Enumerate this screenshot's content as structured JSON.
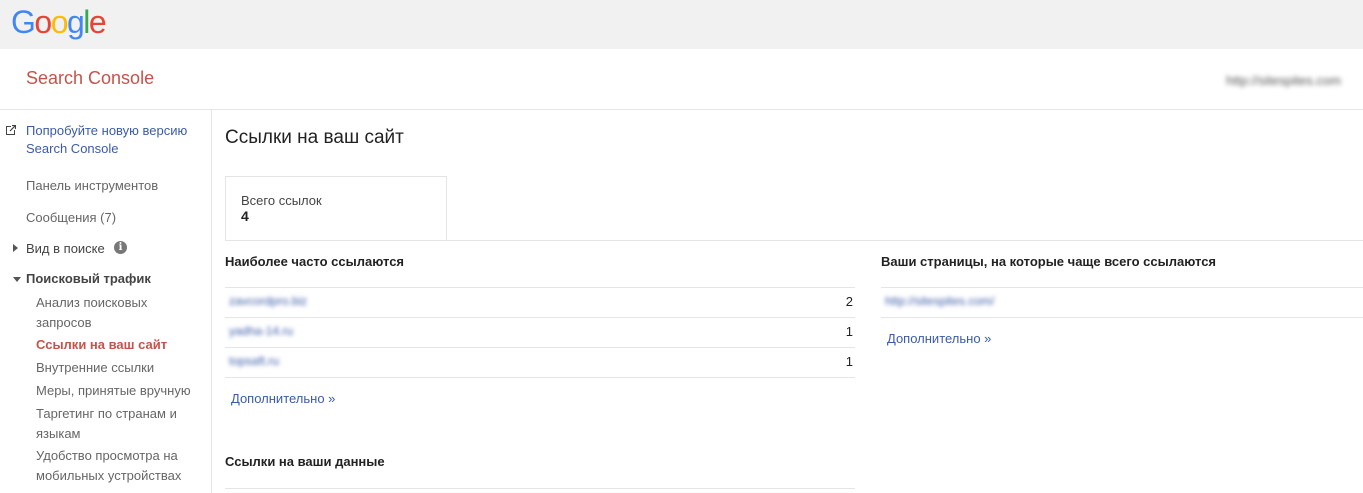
{
  "header": {
    "logo": [
      "G",
      "o",
      "o",
      "g",
      "l",
      "e"
    ],
    "logo_colors": [
      "#4285F4",
      "#EA4335",
      "#FBBC05",
      "#4285F4",
      "#34A853",
      "#EA4335"
    ],
    "app_title": "Search Console",
    "site_url": "http://sitespites.com"
  },
  "sidebar": {
    "try_new": "Попробуйте новую версию Search Console",
    "dashboard": "Панель инструментов",
    "messages": "Сообщения (7)",
    "search_appearance": "Вид в поиске",
    "search_traffic": "Поисковый трафик",
    "sub_items": [
      "Анализ поисковых запросов",
      "Ссылки на ваш сайт",
      "Внутренние ссылки",
      "Меры, принятые вручную",
      "Таргетинг по странам и языкам",
      "Удобство просмотра на мобильных устройствах"
    ]
  },
  "main": {
    "page_title": "Ссылки на ваш сайт",
    "total_label": "Всего ссылок",
    "total_value": "4",
    "most_linking_title": "Наиболее часто ссылаются",
    "most_linking": [
      {
        "domain": "zavcordpro.biz",
        "count": "2"
      },
      {
        "domain": "yadha-14.ru",
        "count": "1"
      },
      {
        "domain": "topsaft.ru",
        "count": "1"
      }
    ],
    "more_label": "Дополнительно »",
    "linked_pages_title": "Ваши страницы, на которые чаще всего ссылаются",
    "linked_pages": [
      {
        "url": "http://sitespites.com/"
      }
    ],
    "linked_pages_more": "Дополнительно »",
    "data_links_title": "Ссылки на ваши данные"
  }
}
